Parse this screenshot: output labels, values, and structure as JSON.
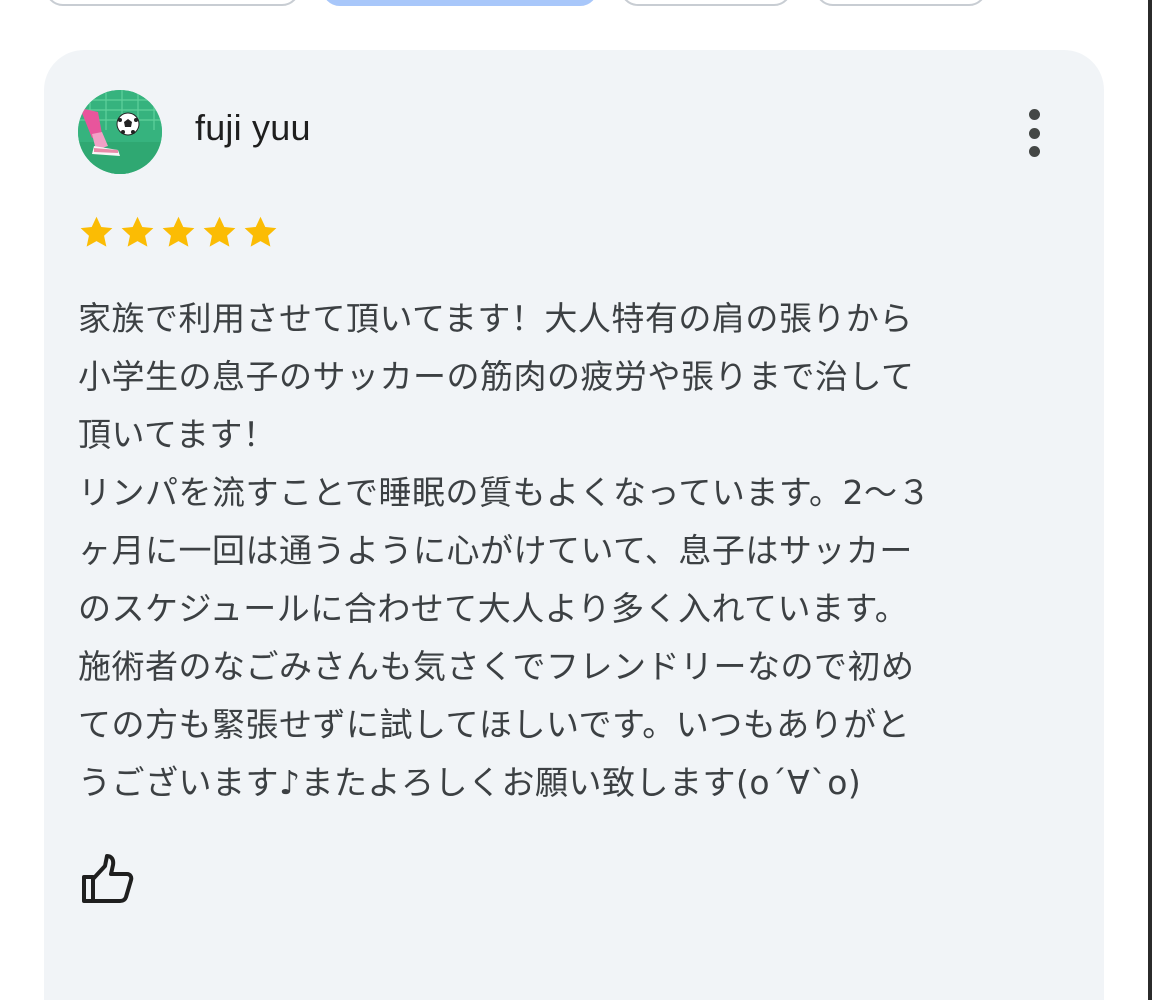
{
  "reviewer": {
    "name": "fuji yuu",
    "avatar_icon": "soccer-avatar"
  },
  "rating": {
    "value": 5,
    "max": 5,
    "star_color": "#fbbc04"
  },
  "review": {
    "text": "家族で利用させて頂いてます！大人特有の肩の張りから\n小学生の息子のサッカーの筋肉の疲労や張りまで治して\n頂いてます！\nリンパを流すことで睡眠の質もよくなっています。2〜３\nヶ月に一回は通うように心がけていて、息子はサッカー\nのスケジュールに合わせて大人より多く入れています。\n施術者のなごみさんも気さくでフレンドリーなので初め\nての方も緊張せずに試してほしいです。いつもありがと\nうございます♪またよろしくお願い致します(o´∀`o)"
  },
  "actions": {
    "more_icon": "more-vert-icon",
    "like_icon": "thumb-up-icon"
  },
  "colors": {
    "card_background": "#f1f4f7",
    "active_chip": "#a8c7fa"
  }
}
